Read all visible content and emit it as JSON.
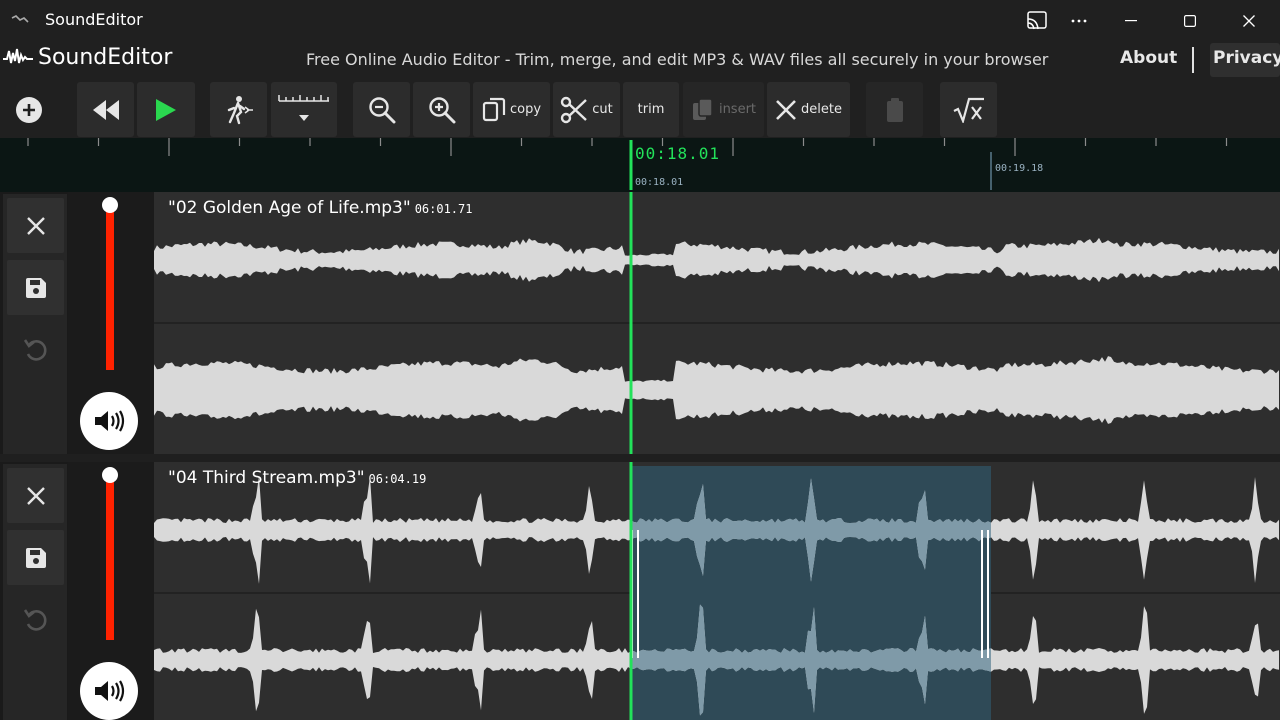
{
  "window": {
    "title": "SoundEditor"
  },
  "header": {
    "brand": "SoundEditor",
    "tagline": "Free Online Audio Editor - Trim, merge, and edit MP3 & WAV files all securely in your browser",
    "about": "About",
    "privacy": "Privacy"
  },
  "toolbar": {
    "copy": "copy",
    "cut": "cut",
    "trim": "trim",
    "insert": "insert",
    "delete": "delete"
  },
  "timeline": {
    "cursor_time": "00:18.01",
    "cursor_time_small": "00:18.01",
    "selection_end_time": "00:19.18"
  },
  "tracks": [
    {
      "name": "\"02 Golden Age of Life.mp3\"",
      "duration": "06:01.71"
    },
    {
      "name": "\"04 Third Stream.mp3\"",
      "duration": "06:04.19"
    }
  ],
  "colors": {
    "cursor": "#22e25a",
    "volume_bar": "#ff2200",
    "selection": "#2f4a57",
    "waveform": "#d9d9d9"
  }
}
